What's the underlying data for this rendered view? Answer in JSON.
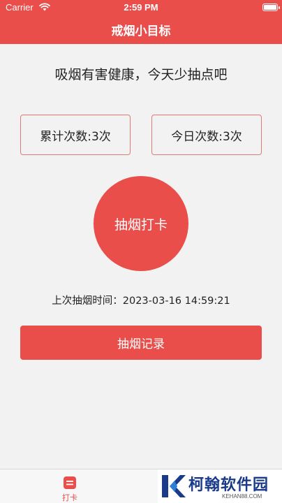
{
  "status_bar": {
    "carrier": "Carrier",
    "time": "2:59 PM"
  },
  "nav": {
    "title": "戒烟小目标"
  },
  "main": {
    "slogan": "吸烟有害健康，今天少抽点吧",
    "total_count": "累计次数:3次",
    "today_count": "今日次数:3次",
    "checkin_label": "抽烟打卡",
    "last_time": "上次抽烟时间：2023-03-16 14:59:21",
    "records_label": "抽烟记录"
  },
  "tabbar": {
    "items": [
      {
        "label": "打卡",
        "icon": "checkin-tab-icon",
        "selected": true
      }
    ]
  },
  "watermark": {
    "name": "柯翰软件园",
    "site": "KEHAN88.COM"
  },
  "colors": {
    "accent": "#e94e4b",
    "background": "#f2f2f2",
    "box_border": "#e07a75"
  }
}
